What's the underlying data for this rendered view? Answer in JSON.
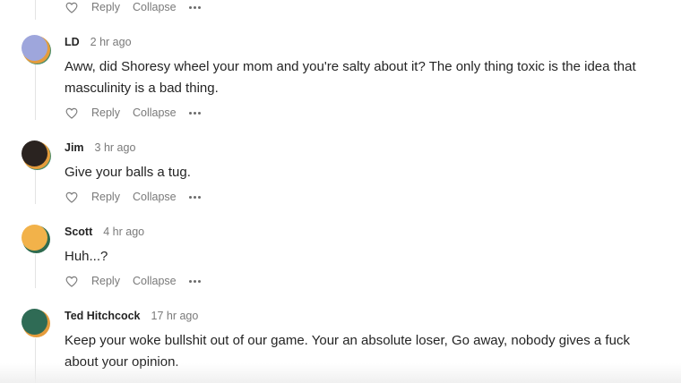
{
  "actions": {
    "reply_label": "Reply",
    "collapse_label": "Collapse",
    "like_icon": "heart-outline-icon",
    "more_icon": "ellipsis-icon"
  },
  "comments": [
    {
      "author": "LD",
      "time": "2 hr ago",
      "avatar_colors": {
        "front": "#9ea6dc",
        "back": "#e59c3c",
        "ring": "#4a8d6a"
      },
      "text": "Aww, did Shoresy wheel your mom and you're salty about it? The only thing toxic is the idea that masculinity is a bad thing."
    },
    {
      "author": "Jim",
      "time": "3 hr ago",
      "avatar_colors": {
        "front": "#2a2320",
        "back": "#e59c3c",
        "ring": "#4a8d6a"
      },
      "text": "Give your balls a tug."
    },
    {
      "author": "Scott",
      "time": "4 hr ago",
      "avatar_colors": {
        "front": "#f2b24a",
        "back": "#2f6b4f",
        "ring": "#2f6b4f"
      },
      "text": "Huh...?"
    },
    {
      "author": "Ted Hitchcock",
      "time": "17 hr ago",
      "avatar_colors": {
        "front": "#2f6b55",
        "back": "#e59c3c",
        "ring": "#e59c3c"
      },
      "text": "Keep your woke bullshit out of our game. Your an absolute loser, Go away, nobody gives a fuck about your opinion."
    }
  ]
}
